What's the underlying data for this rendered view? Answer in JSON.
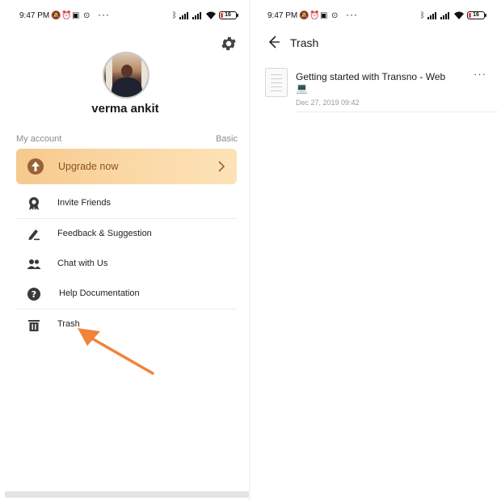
{
  "left": {
    "status": {
      "time": "9:47 PM",
      "battery": "16",
      "more": "···"
    },
    "profile": {
      "name": "verma ankit"
    },
    "account": {
      "label": "My account",
      "tier": "Basic"
    },
    "upgrade": {
      "label": "Upgrade now"
    },
    "menu": [
      {
        "label": "Invite Friends",
        "icon": "award-icon"
      },
      {
        "label": "Feedback & Suggestion",
        "icon": "pen-icon"
      },
      {
        "label": "Chat with Us",
        "icon": "people-icon"
      },
      {
        "label": "Help Documentation",
        "icon": "help-icon"
      },
      {
        "label": "Trash",
        "icon": "trash-icon"
      }
    ],
    "annotation_color": "#f0843a"
  },
  "right": {
    "status": {
      "time": "9:47 PM",
      "battery": "16",
      "more": "···"
    },
    "title": "Trash",
    "notes": [
      {
        "title": "Getting started with Transno - Web 💻",
        "date": "Dec 27, 2019 09:42",
        "more": "···"
      }
    ]
  },
  "colors": {
    "upgrade_start": "#f6c98d",
    "upgrade_end": "#fde3b8",
    "upgrade_text": "#8a5420",
    "accent_brown": "#9a6234"
  }
}
